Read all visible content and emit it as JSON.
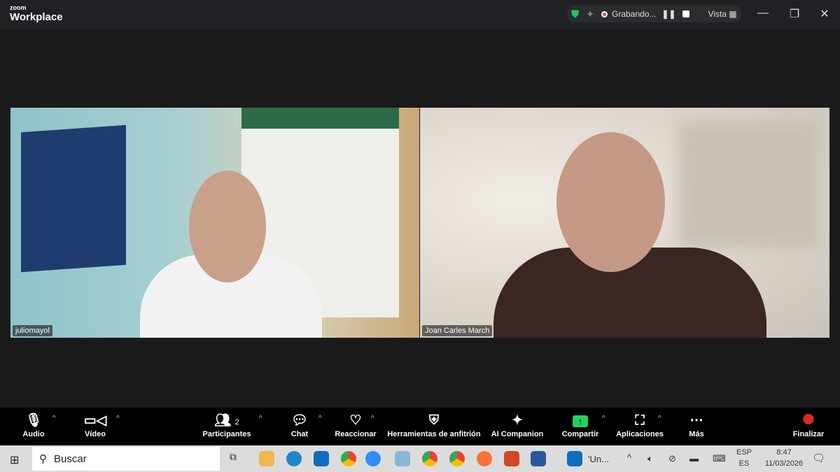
{
  "titlebar": {
    "logo_small": "zoom",
    "logo_big": "Workplace",
    "recording_label": "Grabando...",
    "view_label": "Vista"
  },
  "participants": [
    {
      "name": "juliomayol"
    },
    {
      "name": "Joan Carles March"
    }
  ],
  "toolbar": {
    "audio": "Audio",
    "video": "Vídeo",
    "participants": "Participantes",
    "participants_count": "2",
    "chat": "Chat",
    "react": "Reaccionar",
    "host_tools": "Herramientas de anfitrión",
    "ai": "AI Companion",
    "share": "Compartir",
    "apps": "Aplicaciones",
    "more": "Más",
    "end": "Finalizar"
  },
  "taskbar": {
    "search_placeholder": "Buscar",
    "outlook_window": "'Un...",
    "lang_top": "ESP",
    "lang_bottom": "ES",
    "time": "8:47",
    "date": "11/03/2026"
  },
  "colors": {
    "share": "#23d160",
    "end": "#e02828",
    "shield": "#22c55e"
  }
}
